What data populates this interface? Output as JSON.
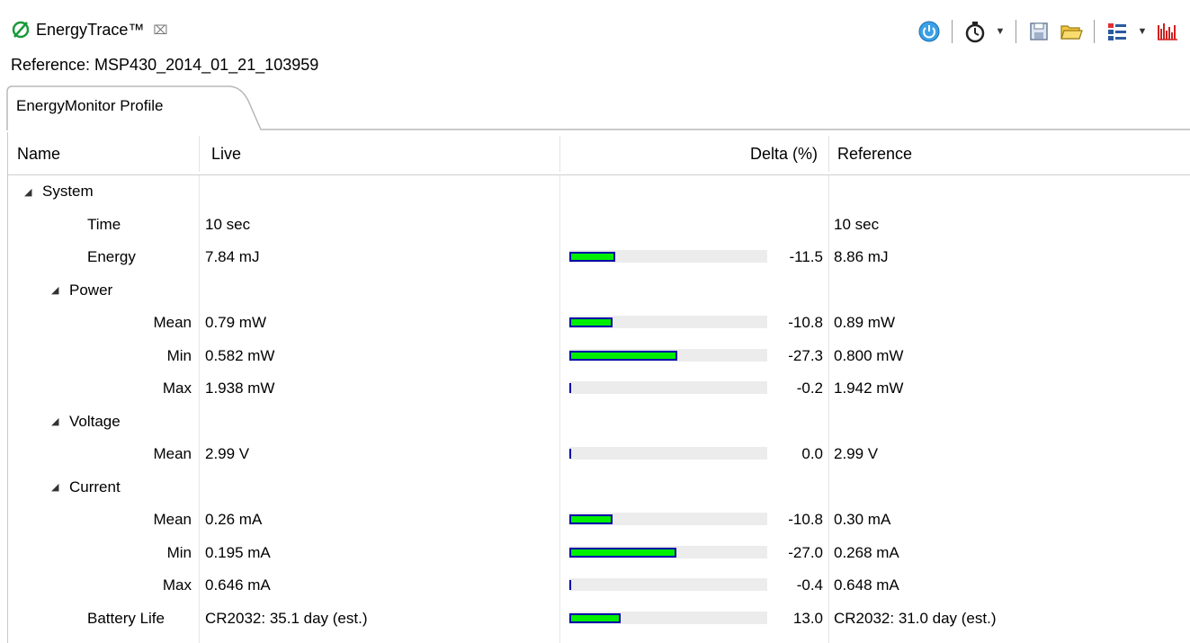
{
  "view": {
    "title": "EnergyTrace™",
    "close_glyph": "⌧",
    "reference_text": "Reference: MSP430_2014_01_21_103959"
  },
  "toolbar": {
    "icons": [
      "power-icon",
      "stopwatch-icon",
      "save-icon",
      "open-folder-icon",
      "layout-icon",
      "energy-graph-icon"
    ],
    "dropdown_glyph": "▼"
  },
  "tabs": {
    "profile": "EnergyMonitor Profile"
  },
  "table": {
    "headers": {
      "name": "Name",
      "live": "Live",
      "delta": "Delta (%)",
      "reference": "Reference"
    },
    "expand_glyph": "◢",
    "rows": [
      {
        "name": "System",
        "group": true,
        "indent": 1
      },
      {
        "name": "Time",
        "indent": 2,
        "live": "10 sec",
        "delta": "",
        "reference": "10 sec"
      },
      {
        "name": "Energy",
        "indent": 2,
        "live": "7.84 mJ",
        "delta": "-11.5",
        "bar": 0.115,
        "reference": "8.86 mJ"
      },
      {
        "name": "Power",
        "group": true,
        "indent": 2
      },
      {
        "name": "Mean",
        "indent": 3,
        "live": "0.79 mW",
        "delta": "-10.8",
        "bar": 0.108,
        "reference": "0.89 mW"
      },
      {
        "name": "Min",
        "indent": 3,
        "live": "0.582 mW",
        "delta": "-27.3",
        "bar": 0.273,
        "reference": "0.800 mW"
      },
      {
        "name": "Max",
        "indent": 3,
        "live": "1.938 mW",
        "delta": "-0.2",
        "bar": 0.002,
        "reference": "1.942 mW"
      },
      {
        "name": "Voltage",
        "group": true,
        "indent": 2
      },
      {
        "name": "Mean",
        "indent": 3,
        "live": "2.99 V",
        "delta": "0.0",
        "bar": 0.0,
        "reference": "2.99 V"
      },
      {
        "name": "Current",
        "group": true,
        "indent": 2
      },
      {
        "name": "Mean",
        "indent": 3,
        "live": "0.26 mA",
        "delta": "-10.8",
        "bar": 0.108,
        "reference": "0.30 mA"
      },
      {
        "name": "Min",
        "indent": 3,
        "live": "0.195 mA",
        "delta": "-27.0",
        "bar": 0.27,
        "reference": "0.268 mA"
      },
      {
        "name": "Max",
        "indent": 3,
        "live": "0.646 mA",
        "delta": "-0.4",
        "bar": 0.004,
        "reference": "0.648 mA"
      },
      {
        "name": "Battery Life",
        "indent": 2,
        "live": "CR2032: 35.1 day (est.)",
        "delta": "13.0",
        "bar": 0.13,
        "reference": "CR2032: 31.0 day (est.)"
      }
    ]
  },
  "colors": {
    "bar_fill": "#00ee00",
    "bar_border": "#0000aa",
    "bar_track": "#ececec"
  }
}
